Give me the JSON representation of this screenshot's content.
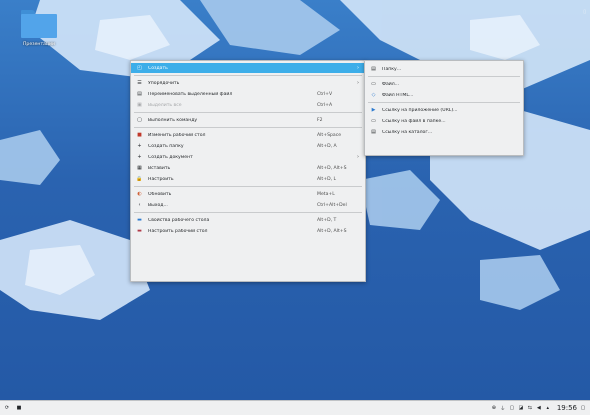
{
  "desktop": {
    "folder_label": "Презентации",
    "corner_indicator": "▯"
  },
  "main_menu": {
    "items": [
      {
        "label": "Создать",
        "shortcut": "",
        "arrow": "›",
        "icon": "new-icon",
        "glyph": "◰",
        "highlighted": true
      },
      {
        "label": "Упорядочить",
        "shortcut": "",
        "arrow": "›",
        "icon": "sort-icon",
        "glyph": "☰"
      },
      {
        "label": "Переименовать выделенный файл",
        "shortcut": "Ctrl+V",
        "arrow": "",
        "icon": "rename-icon",
        "glyph": "▤"
      },
      {
        "label": "Выделить все",
        "shortcut": "Ctrl+A",
        "arrow": "",
        "icon": "select-all-icon",
        "glyph": "▣",
        "disabled": true
      },
      {
        "label": "Выполнить команду",
        "shortcut": "F2",
        "arrow": "",
        "icon": "command-icon",
        "glyph": "▢"
      },
      {
        "label": "Изменить рабочий стол",
        "shortcut": "Alt+Space",
        "arrow": "",
        "icon": "desktop-icon",
        "glyph": "■"
      },
      {
        "label": "Создать папку",
        "shortcut": "Alt+D, A",
        "arrow": "",
        "icon": "add-icon",
        "glyph": "+"
      },
      {
        "label": "Создать документ",
        "shortcut": "",
        "arrow": "›",
        "icon": "add-doc-icon",
        "glyph": "+"
      },
      {
        "label": "Вставить",
        "shortcut": "Alt+D, Alt+S",
        "arrow": "",
        "icon": "paste-icon",
        "glyph": "▦"
      },
      {
        "label": "Настроить",
        "shortcut": "Alt+D, L",
        "arrow": "",
        "icon": "lock-icon",
        "glyph": "🔒"
      },
      {
        "label": "Обновить",
        "shortcut": "Meta+L",
        "arrow": "",
        "icon": "refresh-icon",
        "glyph": "◐"
      },
      {
        "label": "Выход...",
        "shortcut": "Ctrl+Alt+Del",
        "arrow": "",
        "icon": "exit-icon",
        "glyph": "‹"
      },
      {
        "label": "Свойства рабочего стола",
        "shortcut": "Alt+D, T",
        "arrow": "",
        "icon": "properties-icon",
        "glyph": "▬"
      },
      {
        "label": "Настроить рабочий стол",
        "shortcut": "Alt+D, Alt+S",
        "arrow": "",
        "icon": "configure-icon",
        "glyph": "▬"
      }
    ]
  },
  "sub_menu": {
    "items": [
      {
        "label": "Папку...",
        "icon": "folder-new-icon",
        "glyph": "▤"
      },
      {
        "label": "Файл...",
        "icon": "file-icon",
        "glyph": "▭"
      },
      {
        "label": "Файл HTML...",
        "icon": "html-icon",
        "glyph": "◇"
      },
      {
        "label": "Ссылку на приложение (URL)...",
        "icon": "link-app-icon",
        "glyph": "▶"
      },
      {
        "label": "Ссылку на файл в папке...",
        "icon": "link-file-icon",
        "glyph": "▭"
      },
      {
        "label": "Ссылку на каталог...",
        "icon": "link-dir-icon",
        "glyph": "▤"
      }
    ]
  },
  "taskbar": {
    "clock": "19:56",
    "launcher_glyph": "⟳",
    "pager_glyph": "■",
    "tray": [
      "⊕",
      "⏚",
      "▢",
      "◪",
      "⇆",
      "◀",
      "▴"
    ],
    "show_desktop_glyph": "▢"
  }
}
